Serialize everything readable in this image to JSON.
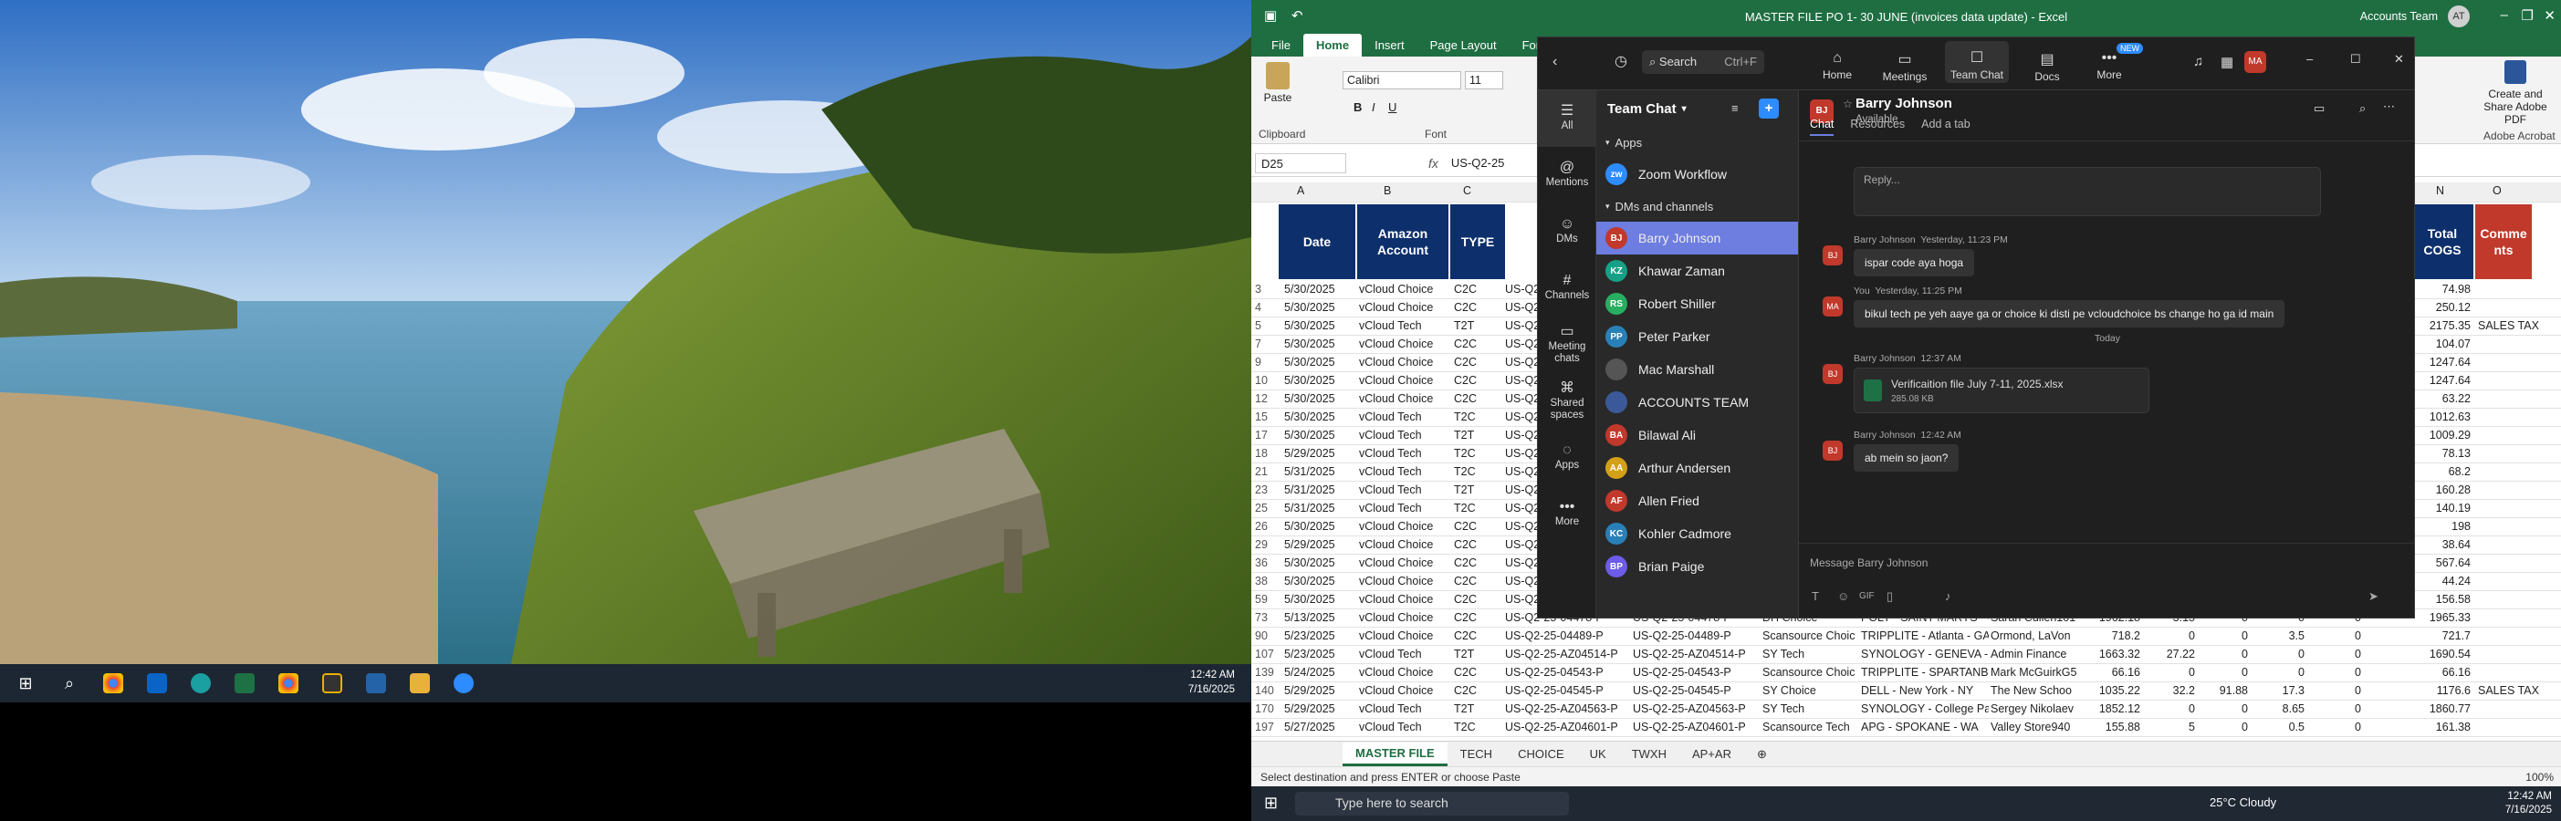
{
  "desktop1": {
    "taskbar": {
      "time": "12:42 AM",
      "date": "7/16/2025"
    }
  },
  "excel": {
    "title": "MASTER FILE PO 1- 30 JUNE (invoices data update)  -  Excel",
    "account": "Accounts Team",
    "account_initials": "AT",
    "tabs": [
      "File",
      "Home",
      "Insert",
      "Page Layout",
      "Formul"
    ],
    "ribbon": {
      "paste": "Paste",
      "clipboard": "Clipboard",
      "font_name": "Calibri",
      "font_size": "11",
      "font_group": "Font",
      "create_pdf": "Create and Share Adobe PDF",
      "adobe": "Adobe Acrobat"
    },
    "name_box": "D25",
    "formula": "US-Q2-25",
    "columns": {
      "A": "A",
      "B": "B",
      "C": "C",
      "N": "N",
      "O": "O"
    },
    "headers": {
      "date": "Date",
      "amazon": "Amazon Account",
      "type": "TYPE",
      "cogs": "Total COGS",
      "comments": "Comme nts"
    },
    "rows": [
      {
        "r": "3",
        "date": "5/30/2025",
        "acct": "vCloud Choice",
        "type": "C2C",
        "id": "US-Q2-",
        "cogs": "74.98",
        "cmt": ""
      },
      {
        "r": "4",
        "date": "5/30/2025",
        "acct": "vCloud Choice",
        "type": "C2C",
        "id": "US-Q2-",
        "cogs": "250.12",
        "cmt": ""
      },
      {
        "r": "5",
        "date": "5/30/2025",
        "acct": "vCloud Tech",
        "type": "T2T",
        "id": "US-Q2-",
        "cogs": "2175.35",
        "cmt": "SALES TAX"
      },
      {
        "r": "7",
        "date": "5/30/2025",
        "acct": "vCloud Choice",
        "type": "C2C",
        "id": "US-Q2-",
        "cogs": "104.07",
        "cmt": ""
      },
      {
        "r": "9",
        "date": "5/30/2025",
        "acct": "vCloud Choice",
        "type": "C2C",
        "id": "US-Q2-",
        "cogs": "1247.64",
        "cmt": ""
      },
      {
        "r": "10",
        "date": "5/30/2025",
        "acct": "vCloud Choice",
        "type": "C2C",
        "id": "US-Q2-",
        "cogs": "1247.64",
        "cmt": ""
      },
      {
        "r": "12",
        "date": "5/30/2025",
        "acct": "vCloud Choice",
        "type": "C2C",
        "id": "US-Q2-",
        "cogs": "63.22",
        "cmt": ""
      },
      {
        "r": "15",
        "date": "5/30/2025",
        "acct": "vCloud Tech",
        "type": "T2C",
        "id": "US-Q2-",
        "cogs": "1012.63",
        "cmt": ""
      },
      {
        "r": "17",
        "date": "5/30/2025",
        "acct": "vCloud Tech",
        "type": "T2T",
        "id": "US-Q2-",
        "cogs": "1009.29",
        "cmt": ""
      },
      {
        "r": "18",
        "date": "5/29/2025",
        "acct": "vCloud Tech",
        "type": "T2C",
        "id": "US-Q2-",
        "cogs": "78.13",
        "cmt": ""
      },
      {
        "r": "21",
        "date": "5/31/2025",
        "acct": "vCloud Tech",
        "type": "T2C",
        "id": "US-Q2-",
        "cogs": "68.2",
        "cmt": ""
      },
      {
        "r": "23",
        "date": "5/31/2025",
        "acct": "vCloud Tech",
        "type": "T2T",
        "id": "US-Q2-",
        "cogs": "160.28",
        "cmt": ""
      },
      {
        "r": "25",
        "date": "5/31/2025",
        "acct": "vCloud Tech",
        "type": "T2C",
        "id": "US-Q2-",
        "cogs": "140.19",
        "cmt": ""
      },
      {
        "r": "26",
        "date": "5/30/2025",
        "acct": "vCloud Choice",
        "type": "C2C",
        "id": "US-Q2-",
        "cogs": "198",
        "cmt": ""
      },
      {
        "r": "29",
        "date": "5/29/2025",
        "acct": "vCloud Choice",
        "type": "C2C",
        "id": "US-Q2-",
        "cogs": "38.64",
        "cmt": ""
      },
      {
        "r": "36",
        "date": "5/30/2025",
        "acct": "vCloud Choice",
        "type": "C2C",
        "id": "US-Q2-",
        "cogs": "567.64",
        "cmt": ""
      },
      {
        "r": "38",
        "date": "5/30/2025",
        "acct": "vCloud Choice",
        "type": "C2C",
        "id": "US-Q2-",
        "cogs": "44.24",
        "cmt": ""
      },
      {
        "r": "59",
        "date": "5/30/2025",
        "acct": "vCloud Choice",
        "type": "C2C",
        "id": "US-Q2-",
        "cogs": "156.58",
        "cmt": ""
      }
    ],
    "full_rows": [
      {
        "r": "73",
        "date": "5/13/2025",
        "acct": "vCloud Choice",
        "type": "C2C",
        "id": "US-Q2-25-04478-P",
        "id2": "US-Q2-25-04478-P",
        "f": "DH Choice",
        "g": "POLY - SAINT MARYS - GA",
        "h": "Sarah Cullen101",
        "i": "1962.18",
        "j": "3.15",
        "k": "0",
        "l": "0",
        "m": "0",
        "cogs": "1965.33",
        "cmt": ""
      },
      {
        "r": "90",
        "date": "5/23/2025",
        "acct": "vCloud Choice",
        "type": "C2C",
        "id": "US-Q2-25-04489-P",
        "id2": "US-Q2-25-04489-P",
        "f": "Scansource Choic",
        "g": "TRIPPLITE - Atlanta - GA",
        "h": "Ormond, LaVon",
        "i": "718.2",
        "j": "0",
        "k": "0",
        "l": "3.5",
        "m": "0",
        "cogs": "721.7",
        "cmt": ""
      },
      {
        "r": "107",
        "date": "5/23/2025",
        "acct": "vCloud Tech",
        "type": "T2T",
        "id": "US-Q2-25-AZ04514-P",
        "id2": "US-Q2-25-AZ04514-P",
        "f": "SY Tech",
        "g": "SYNOLOGY - GENEVA - OH",
        "h": "Admin Finance",
        "i": "1663.32",
        "j": "27.22",
        "k": "0",
        "l": "0",
        "m": "0",
        "cogs": "1690.54",
        "cmt": ""
      },
      {
        "r": "139",
        "date": "5/24/2025",
        "acct": "vCloud Choice",
        "type": "C2C",
        "id": "US-Q2-25-04543-P",
        "id2": "US-Q2-25-04543-P",
        "f": "Scansource Choic",
        "g": "TRIPPLITE - SPARTANBURG - SC",
        "h": "Mark McGuirkG5",
        "i": "66.16",
        "j": "0",
        "k": "0",
        "l": "0",
        "m": "0",
        "cogs": "66.16",
        "cmt": ""
      },
      {
        "r": "140",
        "date": "5/29/2025",
        "acct": "vCloud Choice",
        "type": "C2C",
        "id": "US-Q2-25-04545-P",
        "id2": "US-Q2-25-04545-P",
        "f": "SY Choice",
        "g": "DELL - New York - NY",
        "h": "The New Schoo",
        "i": "1035.22",
        "j": "32.2",
        "k": "91.88",
        "l": "17.3",
        "m": "0",
        "cogs": "1176.6",
        "cmt": "SALES TAX"
      },
      {
        "r": "170",
        "date": "5/29/2025",
        "acct": "vCloud Tech",
        "type": "T2T",
        "id": "US-Q2-25-AZ04563-P",
        "id2": "US-Q2-25-AZ04563-P",
        "f": "SY Tech",
        "g": "SYNOLOGY - College Park - MD",
        "h": "Sergey Nikolaev",
        "i": "1852.12",
        "j": "0",
        "k": "0",
        "l": "8.65",
        "m": "0",
        "cogs": "1860.77",
        "cmt": ""
      },
      {
        "r": "197",
        "date": "5/27/2025",
        "acct": "vCloud Tech",
        "type": "T2C",
        "id": "US-Q2-25-AZ04601-P",
        "id2": "US-Q2-25-AZ04601-P",
        "f": "Scansource Tech",
        "g": "APG - SPOKANE - WA",
        "h": "Valley Store940",
        "i": "155.88",
        "j": "5",
        "k": "0",
        "l": "0.5",
        "m": "0",
        "cogs": "161.38",
        "cmt": ""
      }
    ],
    "sheets": [
      "MASTER FILE",
      "TECH",
      "CHOICE",
      "UK",
      "TWXH",
      "AP+AR"
    ],
    "status": "Select destination and press ENTER or choose Paste",
    "zoom": "100%",
    "taskbar": {
      "search": "Type here to search",
      "weather": "25°C  Cloudy",
      "time": "12:42 AM",
      "date": "7/16/2025"
    }
  },
  "teams": {
    "search": "Search",
    "shortcut": "Ctrl+F",
    "nav": [
      {
        "label": "Home"
      },
      {
        "label": "Meetings"
      },
      {
        "label": "Team Chat"
      },
      {
        "label": "Docs"
      },
      {
        "label": "More",
        "badge": "NEW"
      }
    ],
    "user_initials": "MA",
    "rail": [
      "All",
      "Mentions",
      "DMs",
      "Channels",
      "Meeting chats",
      "Shared spaces",
      "Apps",
      "More"
    ],
    "list_title": "Team Chat",
    "apps_label": "Apps",
    "apps": [
      {
        "name": "Zoom Workflow"
      }
    ],
    "dm_label": "DMs and channels",
    "contacts": [
      {
        "initials": "BJ",
        "name": "Barry Johnson",
        "color": "#c0392b"
      },
      {
        "initials": "KZ",
        "name": "Khawar Zaman",
        "color": "#16a085"
      },
      {
        "initials": "RS",
        "name": "Robert Shiller",
        "color": "#27ae60"
      },
      {
        "initials": "PP",
        "name": "Peter Parker",
        "color": "#2980b9"
      },
      {
        "initials": "",
        "name": "Mac Marshall",
        "color": "#555"
      },
      {
        "initials": "",
        "name": "ACCOUNTS TEAM",
        "color": "#3b5998"
      },
      {
        "initials": "BA",
        "name": "Bilawal Ali",
        "color": "#c0392b"
      },
      {
        "initials": "AA",
        "name": "Arthur Andersen",
        "color": "#d4a017"
      },
      {
        "initials": "AF",
        "name": "Allen Fried",
        "color": "#c0392b"
      },
      {
        "initials": "KC",
        "name": "Kohler Cadmore",
        "color": "#2980b9"
      },
      {
        "initials": "BP",
        "name": "Brian Paige",
        "color": "#6c5ce7"
      }
    ],
    "chat": {
      "name": "Barry Johnson",
      "initials": "BJ",
      "presence": "Available",
      "tabs": [
        "Chat",
        "Resources",
        "Add a tab"
      ],
      "reply_placeholder": "Reply...",
      "messages": [
        {
          "who": "Barry Johnson",
          "when": "Yesterday, 11:23 PM",
          "text": "ispar code aya hoga",
          "initials": "BJ"
        },
        {
          "who": "You",
          "when": "Yesterday, 11:25 PM",
          "text": "bikul tech pe yeh aaye ga or choice ki disti pe vcloudchoice bs change ho ga id main",
          "initials": "MA"
        }
      ],
      "divider": "Today",
      "file_msg": {
        "who": "Barry Johnson",
        "when": "12:37 AM",
        "file": "Verificaition file July 7-11, 2025.xlsx",
        "size": "285.08 KB",
        "initials": "BJ"
      },
      "last_msg": {
        "who": "Barry Johnson",
        "when": "12:42 AM",
        "text": "ab mein so jaon?",
        "initials": "BJ"
      },
      "input_placeholder": "Message Barry Johnson",
      "gif": "GIF"
    }
  }
}
